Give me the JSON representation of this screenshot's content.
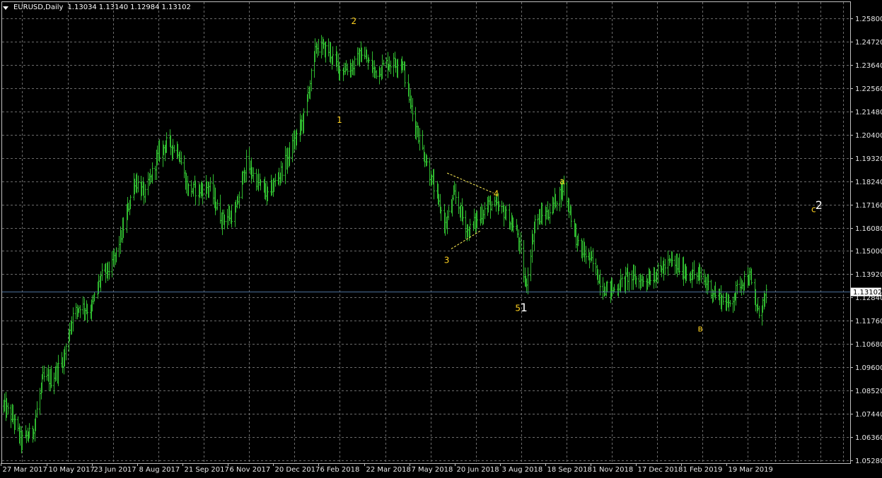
{
  "window": {
    "symbol": "EURUSD",
    "timeframe": "Daily",
    "title_text": "EURUSD,Daily",
    "ohlc": [
      "1.13034",
      "1.13140",
      "1.12984",
      "1.13102"
    ]
  },
  "colors": {
    "background": "#000000",
    "grid": "#6b6b6b",
    "axis": "#c0c0c0",
    "axis_text": "#e6e6e6",
    "candles": "#2fb82f",
    "annotations": "#ffd21f",
    "wave_labels": "#ffffff",
    "current_price_line": "#4a6f99",
    "triangle_lines": "#ffee55"
  },
  "chart_data": {
    "type": "line",
    "series": [
      {
        "x": [
          "2017-03-27",
          "2017-04-05",
          "2017-04-13",
          "2017-04-24",
          "2017-05-04",
          "2017-05-12",
          "2017-05-24",
          "2017-06-01",
          "2017-06-09",
          "2017-06-19",
          "2017-06-29",
          "2017-07-10",
          "2017-07-20",
          "2017-08-01",
          "2017-08-11",
          "2017-08-24",
          "2017-09-01",
          "2017-09-12",
          "2017-09-21",
          "2017-10-02",
          "2017-10-12",
          "2017-10-24",
          "2017-11-06",
          "2017-11-17",
          "2017-11-28",
          "2017-12-08",
          "2017-12-21",
          "2018-01-02",
          "2018-01-12",
          "2018-01-24",
          "2018-02-05",
          "2018-02-16",
          "2018-03-01",
          "2018-03-09",
          "2018-03-22",
          "2018-04-02",
          "2018-04-17",
          "2018-04-27",
          "2018-05-10",
          "2018-05-29",
          "2018-06-07",
          "2018-06-20",
          "2018-07-02",
          "2018-07-11",
          "2018-07-25",
          "2018-08-07",
          "2018-08-15",
          "2018-08-24",
          "2018-09-06",
          "2018-09-21",
          "2018-10-05",
          "2018-10-17",
          "2018-10-29",
          "2018-11-08",
          "2018-11-22",
          "2018-12-05",
          "2018-12-18",
          "2019-01-03",
          "2019-01-17",
          "2019-02-01",
          "2019-02-15",
          "2019-02-28",
          "2019-03-12",
          "2019-03-20",
          "2019-03-28",
          "2019-04-07"
        ],
        "y": [
          1.078,
          1.072,
          1.062,
          1.066,
          1.091,
          1.09,
          1.1,
          1.119,
          1.125,
          1.122,
          1.138,
          1.143,
          1.159,
          1.183,
          1.176,
          1.195,
          1.2,
          1.197,
          1.179,
          1.178,
          1.18,
          1.165,
          1.167,
          1.191,
          1.182,
          1.176,
          1.187,
          1.2,
          1.212,
          1.245,
          1.243,
          1.234,
          1.236,
          1.242,
          1.233,
          1.237,
          1.238,
          1.214,
          1.192,
          1.162,
          1.176,
          1.159,
          1.167,
          1.172,
          1.168,
          1.158,
          1.133,
          1.164,
          1.168,
          1.18,
          1.152,
          1.146,
          1.133,
          1.132,
          1.138,
          1.136,
          1.139,
          1.145,
          1.14,
          1.138,
          1.13,
          1.125,
          1.136,
          1.138,
          1.121,
          1.131
        ]
      }
    ],
    "title": "EURUSD,Daily",
    "ylim": [
      1.0528,
      1.2634
    ],
    "x_tick_labels": [
      "27 Mar 2017",
      "10 May 2017",
      "23 Jun 2017",
      "8 Aug 2017",
      "21 Sep 2017",
      "6 Nov 2017",
      "20 Dec 2017",
      "6 Feb 2018",
      "22 Mar 2018",
      "7 May 2018",
      "20 Jun 2018",
      "3 Aug 2018",
      "18 Sep 2018",
      "1 Nov 2018",
      "17 Dec 2018",
      "1 Feb 2019",
      "19 Mar 2019"
    ],
    "y_tick_labels": [
      "1.25800",
      "1.24720",
      "1.23640",
      "1.22560",
      "1.21480",
      "1.20400",
      "1.19320",
      "1.18240",
      "1.17160",
      "1.16080",
      "1.15000",
      "1.13920",
      "1.12840",
      "1.11760",
      "1.10680",
      "1.09600",
      "1.08520",
      "1.07440",
      "1.06360",
      "1.05280"
    ],
    "current_price": 1.13102,
    "current_price_label": "1.13102",
    "grid": true,
    "annotations": [
      {
        "text": "2",
        "x": "2018-02-27",
        "y": 1.2553,
        "kind": "wave"
      },
      {
        "text": "1",
        "x": "2018-02-13",
        "y": 1.2095,
        "kind": "wave"
      },
      {
        "text": "3",
        "x": "2018-05-28",
        "y": 1.1445,
        "kind": "wave"
      },
      {
        "text": "4",
        "x": "2018-07-15",
        "y": 1.1752,
        "kind": "wave"
      },
      {
        "text": "5",
        "x": "2018-08-05",
        "y": 1.1221,
        "kind": "wave"
      },
      {
        "text": "1",
        "x": "2018-08-10",
        "y": 1.1219,
        "kind": "degree"
      },
      {
        "text": "a",
        "x": "2018-09-17",
        "y": 1.1809,
        "kind": "wave"
      },
      {
        "text": "в",
        "x": "2019-01-29",
        "y": 1.1126,
        "kind": "wave"
      },
      {
        "text": "c",
        "x": "2019-05-19",
        "y": 1.168,
        "kind": "wave"
      },
      {
        "text": "2",
        "x": "2019-05-23",
        "y": 1.1695,
        "kind": "degree"
      }
    ],
    "triangle": [
      [
        [
          "2018-05-31",
          1.1862
        ],
        [
          "2018-07-15",
          1.1769
        ]
      ],
      [
        [
          "2018-06-04",
          1.151
        ],
        [
          "2018-07-02",
          1.1593
        ]
      ]
    ]
  }
}
